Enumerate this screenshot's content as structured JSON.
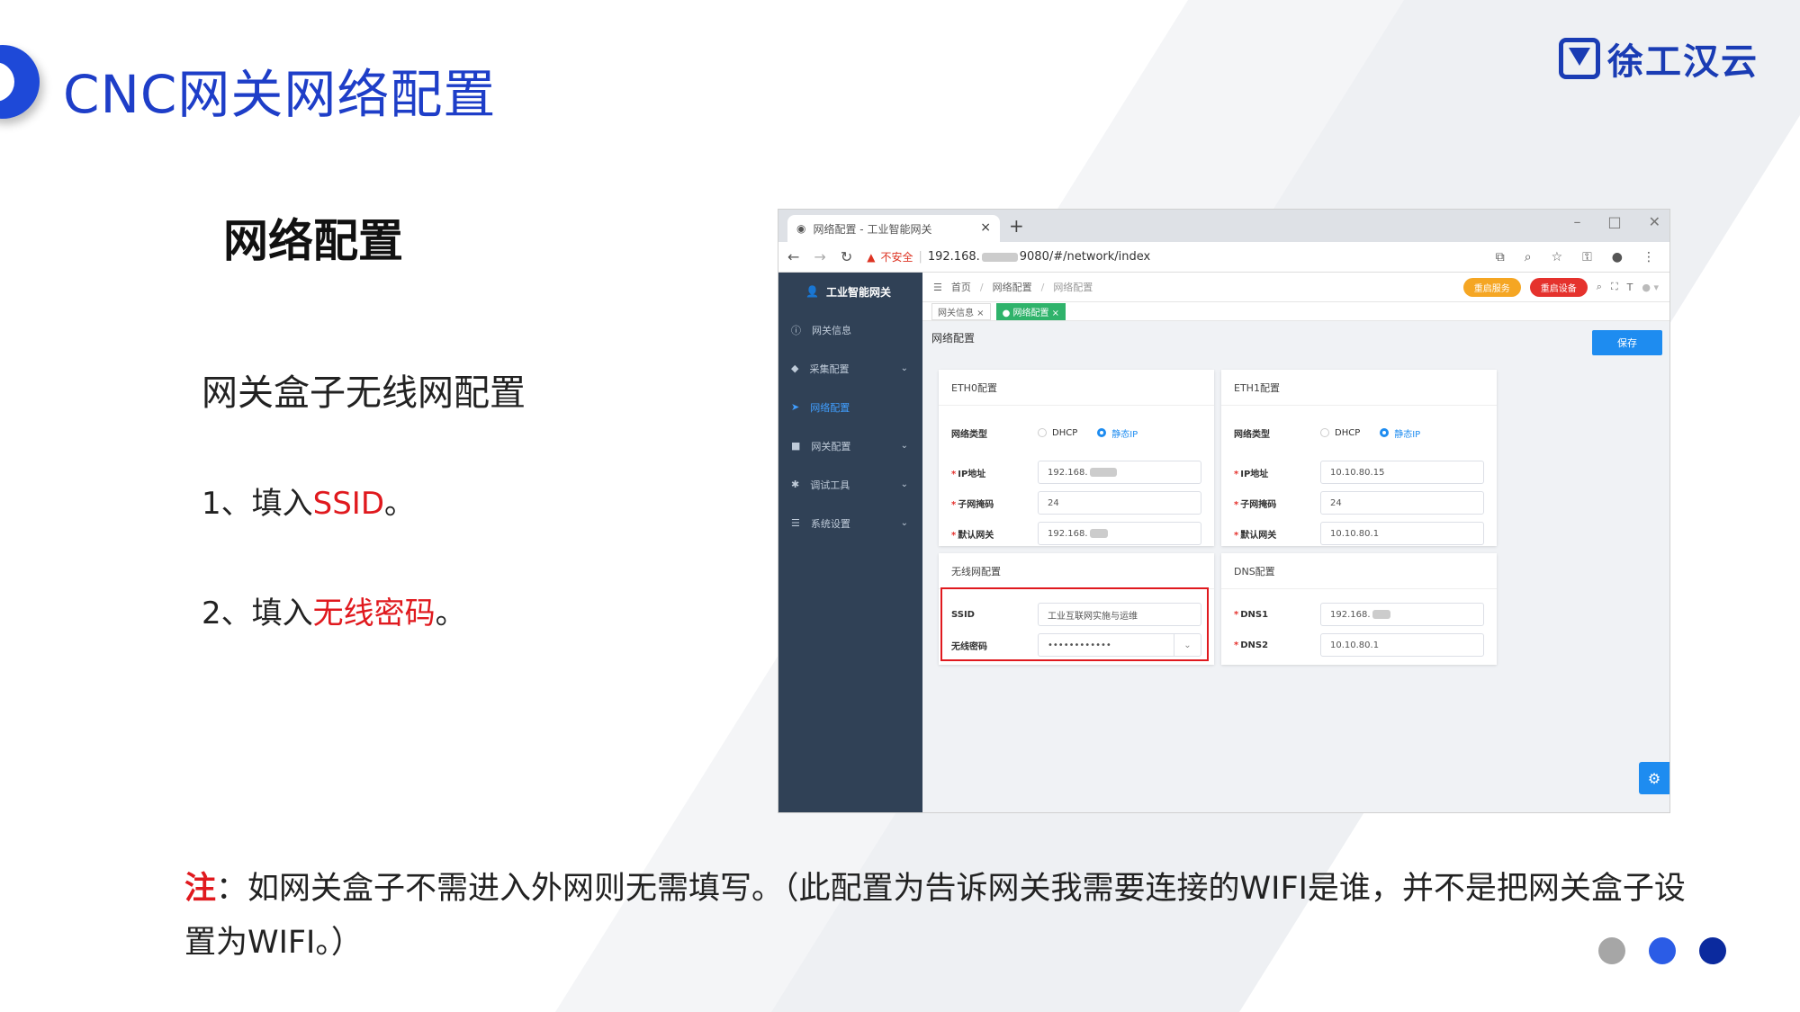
{
  "slide": {
    "title": "CNC网关网络配置",
    "logo_text": "徐工汉云",
    "section_title": "网络配置",
    "subtitle": "网关盒子无线网配置",
    "step1_prefix": "1、填入",
    "step1_highlight": "SSID",
    "step1_suffix": "。",
    "step2_prefix": "2、填入",
    "step2_highlight": "无线密码",
    "step2_suffix": "。",
    "note_label": "注",
    "note_text": "：如网关盒子不需进入外网则无需填写。（此配置为告诉网关我需要连接的WIFI是谁，并不是把网关盒子设置为WIFI。）",
    "dot_colors": [
      "#a6a6a6",
      "#2b5ce6",
      "#0b2a9e"
    ],
    "accent_color": "#1e49d8",
    "highlight_color": "#e0191e"
  },
  "browser": {
    "tab_title": "网络配置 - 工业智能网关",
    "tab_close": "×",
    "new_tab": "+",
    "win_min": "–",
    "win_max": "□",
    "win_close": "✕",
    "insecure_label": "不安全",
    "url_prefix": "192.168.",
    "url_suffix": "9080/#/network/index"
  },
  "app": {
    "brand": "工业智能网关",
    "sidebar": {
      "items": [
        {
          "icon": "info-icon",
          "label": "网关信息",
          "chevron": ""
        },
        {
          "icon": "collect-icon",
          "label": "采集配置",
          "chevron": "⌄"
        },
        {
          "icon": "send-icon",
          "label": "网络配置",
          "chevron": ""
        },
        {
          "icon": "lock-icon",
          "label": "网关配置",
          "chevron": "⌄"
        },
        {
          "icon": "debug-icon",
          "label": "调试工具",
          "chevron": "⌄"
        },
        {
          "icon": "list-icon",
          "label": "系统设置",
          "chevron": "⌄"
        }
      ]
    },
    "breadcrumb": {
      "home": "首页",
      "sep": "/",
      "level2": "网络配置",
      "current": "网络配置"
    },
    "restart_service": "重启服务",
    "restart_device": "重启设备",
    "tags": [
      {
        "label": "网关信息 ×"
      },
      {
        "label": "● 网络配置 ×"
      }
    ],
    "panel_title": "网络配置",
    "save_label": "保存",
    "eth0": {
      "title": "ETH0配置",
      "net_type_label": "网络类型",
      "opt_dhcp": "DHCP",
      "opt_static": "静态IP",
      "ip_label": "IP地址",
      "ip_value": "192.168.",
      "mask_label": "子网掩码",
      "mask_value": "24",
      "gw_label": "默认网关",
      "gw_value": "192.168."
    },
    "eth1": {
      "title": "ETH1配置",
      "net_type_label": "网络类型",
      "opt_dhcp": "DHCP",
      "opt_static": "静态IP",
      "ip_label": "IP地址",
      "ip_value": "10.10.80.15",
      "mask_label": "子网掩码",
      "mask_value": "24",
      "gw_label": "默认网关",
      "gw_value": "10.10.80.1"
    },
    "wifi": {
      "title": "无线网配置",
      "ssid_label": "SSID",
      "ssid_value": "工业互联网实施与运维",
      "pwd_label": "无线密码",
      "pwd_value": "••••••••••••"
    },
    "dns": {
      "title": "DNS配置",
      "dns1_label": "DNS1",
      "dns1_value": "192.168.",
      "dns2_label": "DNS2",
      "dns2_value": "10.10.80.1"
    },
    "asterisk": "*"
  }
}
